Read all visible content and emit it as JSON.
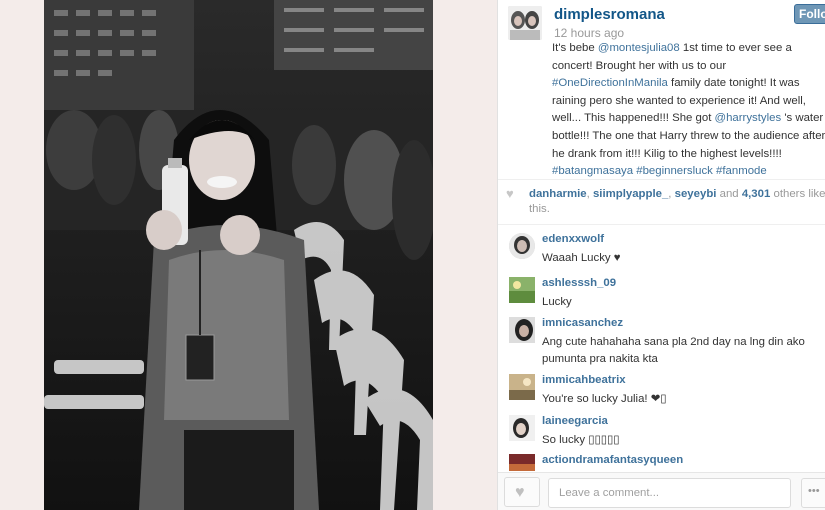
{
  "post": {
    "username": "dimplesromana",
    "timestamp": "12 hours ago",
    "follow_label": "Follow",
    "caption": {
      "t1": "It's bebe ",
      "m1": "@montesjulia08",
      "t2": " 1st time to ever see a concert! Brought her with us to our ",
      "h1": "#OneDirectionInManila",
      "t3": " family date tonight! It was raining pero she wanted to experience it! And well, well... This happened!!! She got ",
      "m2": "@harrystyles",
      "t4": " 's water bottle!!! The one that Harry threw to the audience after he drank from it!!! Kilig to the highest levels!!!! ",
      "h2": "#batangmasaya",
      "h3": "#beginnersluck",
      "h4": "#fanmode"
    }
  },
  "likes": {
    "icon": "heart-icon",
    "user1": "danharmie",
    "user2": "siimplyapple_",
    "user3": "seyeybi",
    "count": "4,301",
    "and_label": "and",
    "suffix": "others like this."
  },
  "comments": [
    {
      "user": "edenxxwolf",
      "text": "Waaah Lucky ♥"
    },
    {
      "user": "ashlesssh_09",
      "text": "Lucky"
    },
    {
      "user": "imnicasanchez",
      "text": "Ang cute hahahaha sana pla 2nd day na lng din ako pumunta pra nakita kta"
    },
    {
      "user": "immicahbeatrix",
      "text": "You're so lucky Julia! ❤▯"
    },
    {
      "user": "laineegarcia",
      "text": "So lucky ▯▯▯▯▯"
    },
    {
      "user": "actiondramafantasyqueen",
      "text": ""
    }
  ],
  "footer": {
    "comment_placeholder": "Leave a comment...",
    "more_label": "•••"
  }
}
